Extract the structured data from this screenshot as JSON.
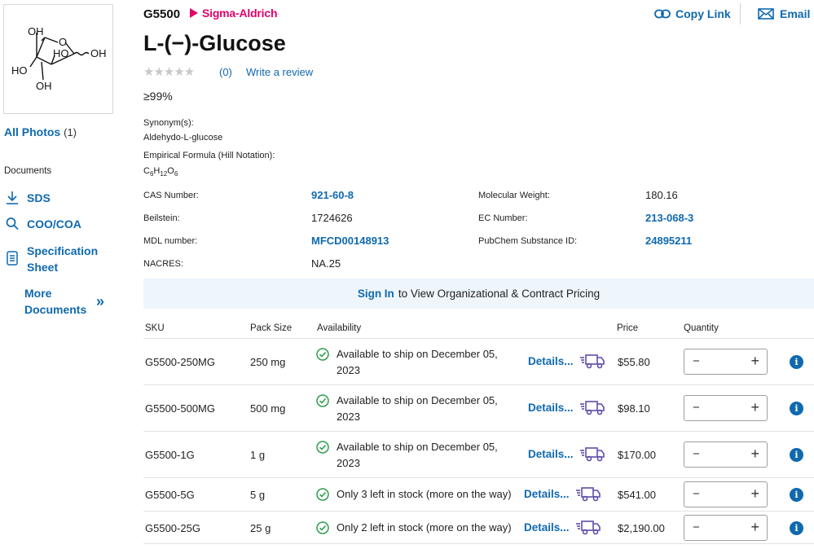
{
  "gallery": {
    "all_photos_label": "All Photos",
    "photo_count": "(1)"
  },
  "structure": {
    "oh_top": "OH",
    "ho_ring": "HO",
    "oh_right": "OH",
    "ho_left": "HO",
    "oh_bottom": "OH",
    "o_ring": "O"
  },
  "documents": {
    "title": "Documents",
    "items": [
      {
        "label": "SDS",
        "icon": "download-icon"
      },
      {
        "label": "COO/COA",
        "icon": "search-icon"
      },
      {
        "label": "Specification Sheet",
        "icon": "document-icon"
      }
    ],
    "more_label": "More Documents",
    "more_icon": "double-chevron-right-icon"
  },
  "header": {
    "sku": "G5500",
    "brand": "Sigma-Aldrich",
    "brand_reg": ".",
    "copy_link": "Copy Link",
    "email": "Email",
    "title": "L-(−)-Glucose",
    "stars": "★★★★★",
    "review_count": "(0)",
    "write_review": "Write a review",
    "purity": "≥99%"
  },
  "synonyms": {
    "label": "Synonym(s):",
    "value": "Aldehydo-L-glucose"
  },
  "formula": {
    "label": "Empirical Formula (Hill Notation):",
    "c": "C",
    "c_n": "6",
    "h": "H",
    "h_n": "12",
    "o": "O",
    "o_n": "6"
  },
  "properties": {
    "cas_label": "CAS Number:",
    "cas_value": "921-60-8",
    "mw_label": "Molecular Weight:",
    "mw_value": "180.16",
    "beilstein_label": "Beilstein:",
    "beilstein_value": "1724626",
    "ec_label": "EC Number:",
    "ec_value": "213-068-3",
    "mdl_label": "MDL number:",
    "mdl_value": "MFCD00148913",
    "pubchem_label": "PubChem Substance ID:",
    "pubchem_value": "24895211",
    "nacres_label": "NACRES:",
    "nacres_value": "NA.25"
  },
  "banner": {
    "sign_in": "Sign In",
    "text": "to View Organizational & Contract Pricing"
  },
  "table": {
    "headers": {
      "sku": "SKU",
      "pack": "Pack Size",
      "availability": "Availability",
      "price": "Price",
      "quantity": "Quantity"
    },
    "rows": [
      {
        "sku": "G5500-250MG",
        "pack": "250 mg",
        "availability": "Available to ship on December 05, 2023",
        "details": "Details...",
        "price": "$55.80"
      },
      {
        "sku": "G5500-500MG",
        "pack": "500 mg",
        "availability": "Available to ship on December 05, 2023",
        "details": "Details...",
        "price": "$98.10"
      },
      {
        "sku": "G5500-1G",
        "pack": "1 g",
        "availability": "Available to ship on December 05, 2023",
        "details": "Details...",
        "price": "$170.00"
      },
      {
        "sku": "G5500-5G",
        "pack": "5 g",
        "availability": "Only 3 left in stock (more on the way)",
        "details": "Details...",
        "price": "$541.00"
      },
      {
        "sku": "G5500-25G",
        "pack": "25 g",
        "availability": "Only 2 left in stock (more on the way)",
        "details": "Details...",
        "price": "$2,190.00"
      }
    ],
    "minus": "−",
    "plus": "+",
    "info": "i"
  },
  "colors": {
    "link": "#0f69af",
    "brand": "#e2006a",
    "success": "#2e9e4f",
    "truck": "#5b4fa8",
    "banner_bg": "#eef6fb"
  }
}
